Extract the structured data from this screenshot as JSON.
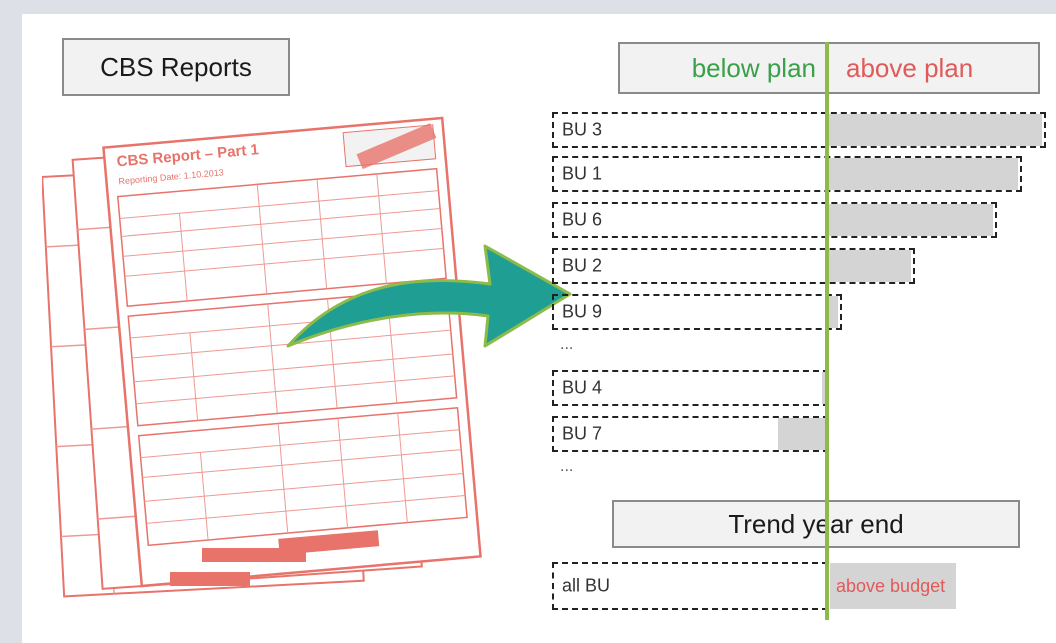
{
  "title": "CBS Reports",
  "document": {
    "heading": "CBS Report – Part 1",
    "reporting_date": "Reporting Date: 1.10.2013"
  },
  "header": {
    "below": "below plan",
    "above": "above plan"
  },
  "rows": [
    {
      "label": "BU 3",
      "value": 1.0
    },
    {
      "label": "BU 1",
      "value": 0.89
    },
    {
      "label": "BU 6",
      "value": 0.77
    },
    {
      "label": "BU 2",
      "value": 0.39
    },
    {
      "label": "BU 9",
      "value": 0.05
    },
    {
      "label": "BU 4",
      "value": -0.04
    },
    {
      "label": "BU 7",
      "value": -0.38
    }
  ],
  "ellipsis": "...",
  "trend": {
    "title": "Trend year end",
    "row_label": "all BU",
    "status": "above budget"
  },
  "colors": {
    "below": "#3aa04a",
    "above": "#e05a5a",
    "line": "#8dbb4a",
    "bar": "#d4d4d4",
    "doc": "#e8736b"
  }
}
